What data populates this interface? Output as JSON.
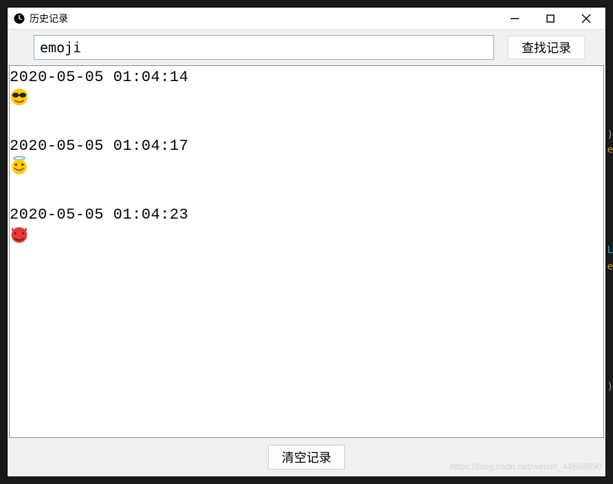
{
  "window": {
    "title": "历史记录"
  },
  "search": {
    "value": "emoji",
    "button_label": "查找记录"
  },
  "records": [
    {
      "timestamp": "2020-05-05 01:04:14",
      "emoji_name": "sunglasses-emoji"
    },
    {
      "timestamp": "2020-05-05 01:04:17",
      "emoji_name": "halo-emoji"
    },
    {
      "timestamp": "2020-05-05 01:04:23",
      "emoji_name": "devil-emoji"
    }
  ],
  "footer": {
    "clear_label": "清空记录"
  },
  "watermark": "https://blog.csdn.net/weixin_44868890"
}
